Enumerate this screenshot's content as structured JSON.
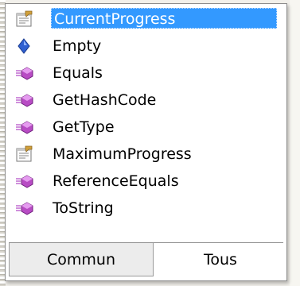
{
  "items": [
    {
      "label": "CurrentProgress",
      "icon": "property-icon",
      "selected": true
    },
    {
      "label": "Empty",
      "icon": "field-icon",
      "selected": false
    },
    {
      "label": "Equals",
      "icon": "method-icon",
      "selected": false
    },
    {
      "label": "GetHashCode",
      "icon": "method-icon",
      "selected": false
    },
    {
      "label": "GetType",
      "icon": "method-icon",
      "selected": false
    },
    {
      "label": "MaximumProgress",
      "icon": "property-icon",
      "selected": false
    },
    {
      "label": "ReferenceEquals",
      "icon": "method-icon",
      "selected": false
    },
    {
      "label": "ToString",
      "icon": "method-icon",
      "selected": false
    }
  ],
  "tabs": {
    "common": "Commun",
    "all": "Tous",
    "active": "common"
  },
  "colors": {
    "selection": "#3399ff",
    "selection_text": "#ffffff",
    "method_icon": "#b84cc4",
    "field_icon": "#2f5fd0"
  }
}
